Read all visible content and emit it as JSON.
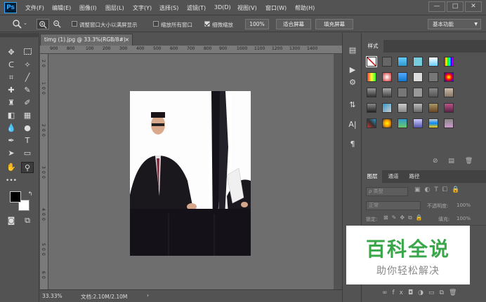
{
  "app": {
    "logo": "Ps"
  },
  "menu": [
    "文件(F)",
    "编辑(E)",
    "图像(I)",
    "图层(L)",
    "文字(Y)",
    "选择(S)",
    "滤镜(T)",
    "3D(D)",
    "视图(V)",
    "窗口(W)",
    "帮助(H)"
  ],
  "window_controls": {
    "minimize": "—",
    "maximize": "□",
    "close": "✕"
  },
  "options_bar": {
    "zoom_tool_icon": "magnifier-icon",
    "check_resize_window": {
      "label": "调整窗口大小以满屏显示",
      "checked": false
    },
    "check_zoom_all": {
      "label": "缩放所有窗口",
      "checked": false
    },
    "check_scrubby_zoom": {
      "label": "细微缩放",
      "checked": true
    },
    "zoom_value": "100%",
    "fit_screen": "适合屏幕",
    "fill_screen": "填充屏幕",
    "workspace": "基本功能"
  },
  "document": {
    "tab_title": "timg (1).jpg @ 33.3%(RGB/8#)",
    "close_symbol": "×",
    "ruler_ticks": [
      "900",
      "800",
      "100",
      "200",
      "300",
      "400",
      "500",
      "600",
      "700",
      "800",
      "900",
      "1000",
      "1100",
      "1200",
      "1300",
      "1400"
    ],
    "ruler_left_ticks": [
      "2",
      "0",
      "1",
      "0",
      "0",
      "2",
      "0",
      "0",
      "3",
      "0",
      "0",
      "4",
      "0",
      "0",
      "5",
      "0",
      "0",
      "6",
      "0"
    ]
  },
  "status": {
    "zoom": "33.33%",
    "doc_info": "文档:2.10M/2.10M"
  },
  "swatches_panel": {
    "title": "样式"
  },
  "layers_panel": {
    "tabs": [
      "图层",
      "通道",
      "路径"
    ],
    "filter_kind": "ρ 类型",
    "blend_mode": "正常",
    "opacity_label": "不透明度:",
    "opacity_value": "100%",
    "lock_label": "锁定:",
    "fill_label": "填充:",
    "fill_value": "100%"
  },
  "watermark": {
    "title": "百科全说",
    "subtitle": "助你轻松解决"
  },
  "colors": {
    "ui_bg": "#535353",
    "canvas_bg": "#6e6e6e",
    "accent": "#31a8ff",
    "watermark_green": "#3aa64a"
  }
}
